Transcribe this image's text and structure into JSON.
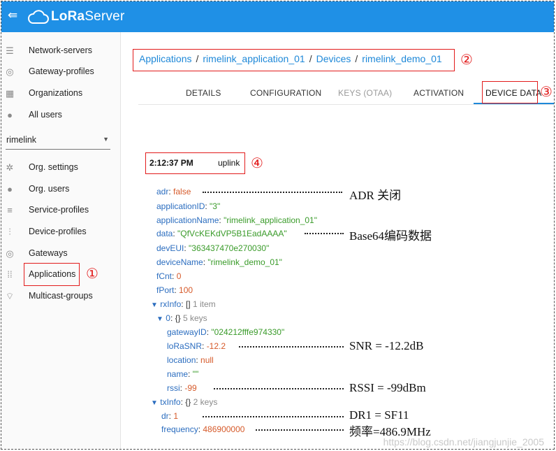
{
  "app": {
    "title_a": "LoRa",
    "title_b": "Server"
  },
  "sidebar": {
    "items": [
      {
        "label": "Network-servers",
        "icon": "server-icon"
      },
      {
        "label": "Gateway-profiles",
        "icon": "broadcast-icon"
      },
      {
        "label": "Organizations",
        "icon": "building-icon"
      },
      {
        "label": "All users",
        "icon": "user-icon"
      }
    ],
    "org_select": "rimelink",
    "org_items": [
      {
        "label": "Org. settings",
        "icon": "gear-icon"
      },
      {
        "label": "Org. users",
        "icon": "user-icon"
      },
      {
        "label": "Service-profiles",
        "icon": "account-list-icon"
      },
      {
        "label": "Device-profiles",
        "icon": "sliders-icon"
      },
      {
        "label": "Gateways",
        "icon": "broadcast-icon"
      },
      {
        "label": "Applications",
        "icon": "apps-grid-icon"
      },
      {
        "label": "Multicast-groups",
        "icon": "rss-icon"
      }
    ]
  },
  "breadcrumb": [
    "Applications",
    "rimelink_application_01",
    "Devices",
    "rimelink_demo_01"
  ],
  "tabs": [
    "DETAILS",
    "CONFIGURATION",
    "KEYS (OTAA)",
    "ACTIVATION",
    "DEVICE DATA"
  ],
  "event": {
    "time": "2:12:37 PM",
    "type": "uplink"
  },
  "json": {
    "adr": {
      "k": "adr",
      "v": "false"
    },
    "applicationID": {
      "k": "applicationID",
      "v": "\"3\""
    },
    "applicationName": {
      "k": "applicationName",
      "v": "\"rimelink_application_01\""
    },
    "data": {
      "k": "data",
      "v": "\"QfVcKEKdVP5B1EadAAAA\""
    },
    "devEUI": {
      "k": "devEUI",
      "v": "\"363437470e270030\""
    },
    "deviceName": {
      "k": "deviceName",
      "v": "\"rimelink_demo_01\""
    },
    "fCnt": {
      "k": "fCnt",
      "v": "0"
    },
    "fPort": {
      "k": "fPort",
      "v": "100"
    },
    "rxInfo": {
      "k": "rxInfo",
      "brackets": "[]",
      "meta": "1 item"
    },
    "rx0": {
      "k": "0",
      "brackets": "{}",
      "meta": "5 keys"
    },
    "gatewayID": {
      "k": "gatewayID",
      "v": "\"024212fffe974330\""
    },
    "loRaSNR": {
      "k": "loRaSNR",
      "v": "-12.2"
    },
    "location": {
      "k": "location",
      "v": "null"
    },
    "name": {
      "k": "name",
      "v": "\"\""
    },
    "rssi": {
      "k": "rssi",
      "v": "-99"
    },
    "txInfo": {
      "k": "txInfo",
      "brackets": "{}",
      "meta": "2 keys"
    },
    "dr": {
      "k": "dr",
      "v": "1"
    },
    "frequency": {
      "k": "frequency",
      "v": "486900000"
    }
  },
  "annotations": {
    "adr": "ADR 关闭",
    "data": "Base64编码数据",
    "snr": "SNR = -12.2dB",
    "rssi": "RSSI = -99dBm",
    "dr": "DR1 = SF11",
    "freq": "频率=486.9MHz"
  },
  "markers": [
    "①",
    "②",
    "③",
    "④"
  ],
  "watermark": "https://blog.csdn.net/jiangjunjie_2005",
  "colors": {
    "topbar": "#1f90e6",
    "link": "#1e88d8",
    "marker": "#e21b1b",
    "json_key": "#2b6dbf",
    "json_string": "#3a9b2a",
    "json_number": "#d65a2a"
  }
}
